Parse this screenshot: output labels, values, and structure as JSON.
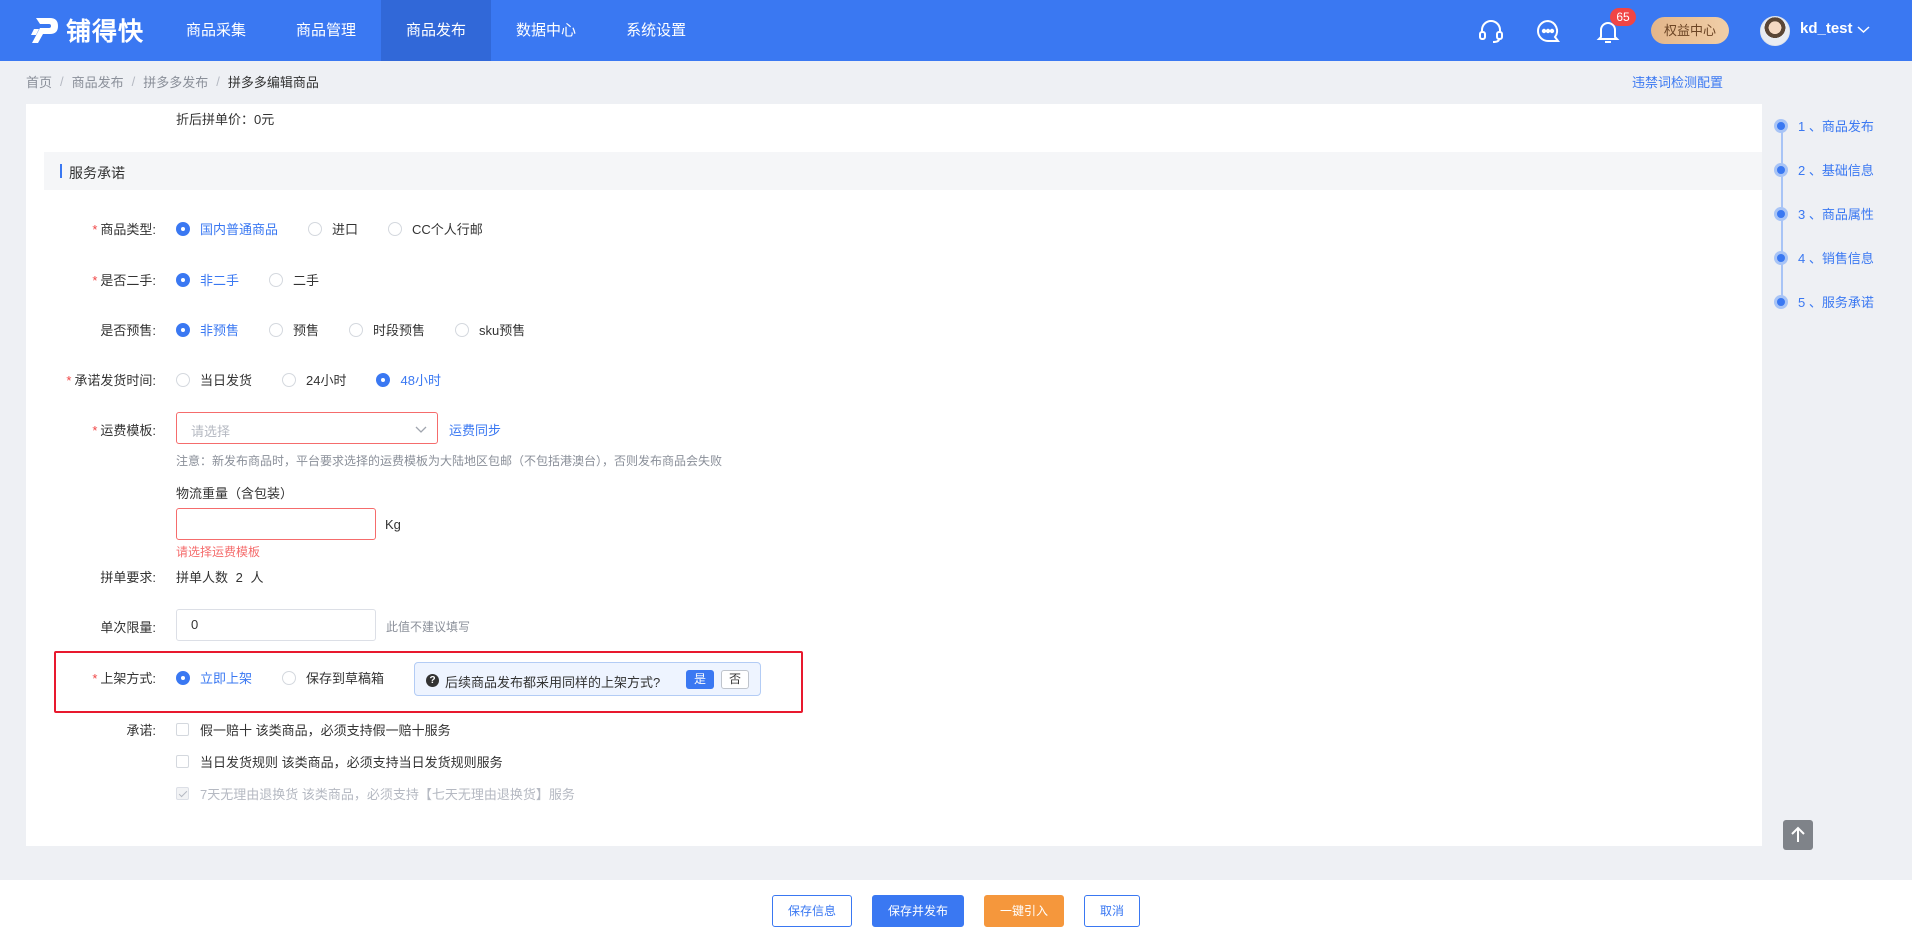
{
  "brand": {
    "name": "铺得快"
  },
  "nav": [
    "商品采集",
    "商品管理",
    "商品发布",
    "数据中心",
    "系统设置"
  ],
  "header": {
    "notification_count": "65",
    "vip_label": "权益中心",
    "username": "kd_test"
  },
  "breadcrumb": [
    "首页",
    "商品发布",
    "拼多多发布",
    "拼多多编辑商品"
  ],
  "top_link": "违禁词检测配置",
  "form": {
    "discount_price": "折后拼单价：0元",
    "section_title": "服务承诺",
    "product_type": {
      "label": "商品类型:",
      "options": [
        "国内普通商品",
        "进口",
        "CC个人行邮"
      ],
      "selected": "国内普通商品"
    },
    "second_hand": {
      "label": "是否二手:",
      "options": [
        "非二手",
        "二手"
      ],
      "selected": "非二手"
    },
    "presale": {
      "label": "是否预售:",
      "options": [
        "非预售",
        "预售",
        "时段预售",
        "sku预售"
      ],
      "selected": "非预售"
    },
    "ship_time": {
      "label": "承诺发货时间:",
      "options": [
        "当日发货",
        "24小时",
        "48小时"
      ],
      "selected": "48小时"
    },
    "freight": {
      "label": "运费模板:",
      "placeholder": "请选择",
      "sync_link": "运费同步",
      "note": "注意：新发布商品时，平台要求选择的运费模板为大陆地区包邮（不包括港澳台），否则发布商品会失败",
      "weight_label": "物流重量（含包装）",
      "weight_unit": "Kg",
      "error": "请选择运费模板"
    },
    "group_req": {
      "label": "拼单要求:",
      "value": "拼单人数 2 人"
    },
    "limit": {
      "label": "单次限量:",
      "value": "0",
      "hint": "此值不建议填写"
    },
    "listing": {
      "label": "上架方式:",
      "options": [
        "立即上架",
        "保存到草稿箱"
      ],
      "selected": "立即上架",
      "tip": "后续商品发布都采用同样的上架方式?",
      "yes": "是",
      "no": "否"
    },
    "promise": {
      "label": "承诺:",
      "items": [
        "假一赔十 该类商品，必须支持假一赔十服务",
        "当日发货规则 该类商品，必须支持当日发货规则服务",
        "7天无理由退换货 该类商品，必须支持【七天无理由退换货】服务"
      ]
    }
  },
  "steps": [
    "1 、商品发布",
    "2 、基础信息",
    "3 、商品属性",
    "4 、销售信息",
    "5 、服务承诺"
  ],
  "footer": {
    "save": "保存信息",
    "save_publish": "保存并发布",
    "import": "一键引入",
    "cancel": "取消"
  }
}
